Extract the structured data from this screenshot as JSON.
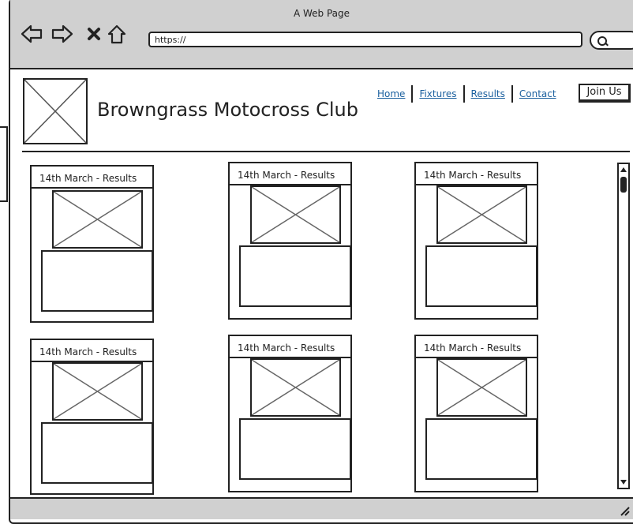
{
  "browser": {
    "window_title": "A Web Page",
    "url": "https://"
  },
  "site": {
    "title": "Browngrass Motocross Club",
    "nav": [
      {
        "label": "Home"
      },
      {
        "label": "Fixtures"
      },
      {
        "label": "Results"
      },
      {
        "label": "Contact"
      }
    ],
    "join_label": "Join Us"
  },
  "cards": [
    {
      "title": "14th March - Results"
    },
    {
      "title": "14th March - Results"
    },
    {
      "title": "14th March - Results"
    },
    {
      "title": "14th March - Results"
    },
    {
      "title": "14th March - Results"
    },
    {
      "title": "14th March - Results"
    }
  ],
  "icons": {
    "back": "arrow-left-icon",
    "forward": "arrow-right-icon",
    "stop": "close-icon",
    "home": "home-icon",
    "search": "search-icon",
    "scroll_up": "triangle-up-icon",
    "scroll_down": "triangle-down-icon",
    "resize": "resize-grip-icon"
  }
}
